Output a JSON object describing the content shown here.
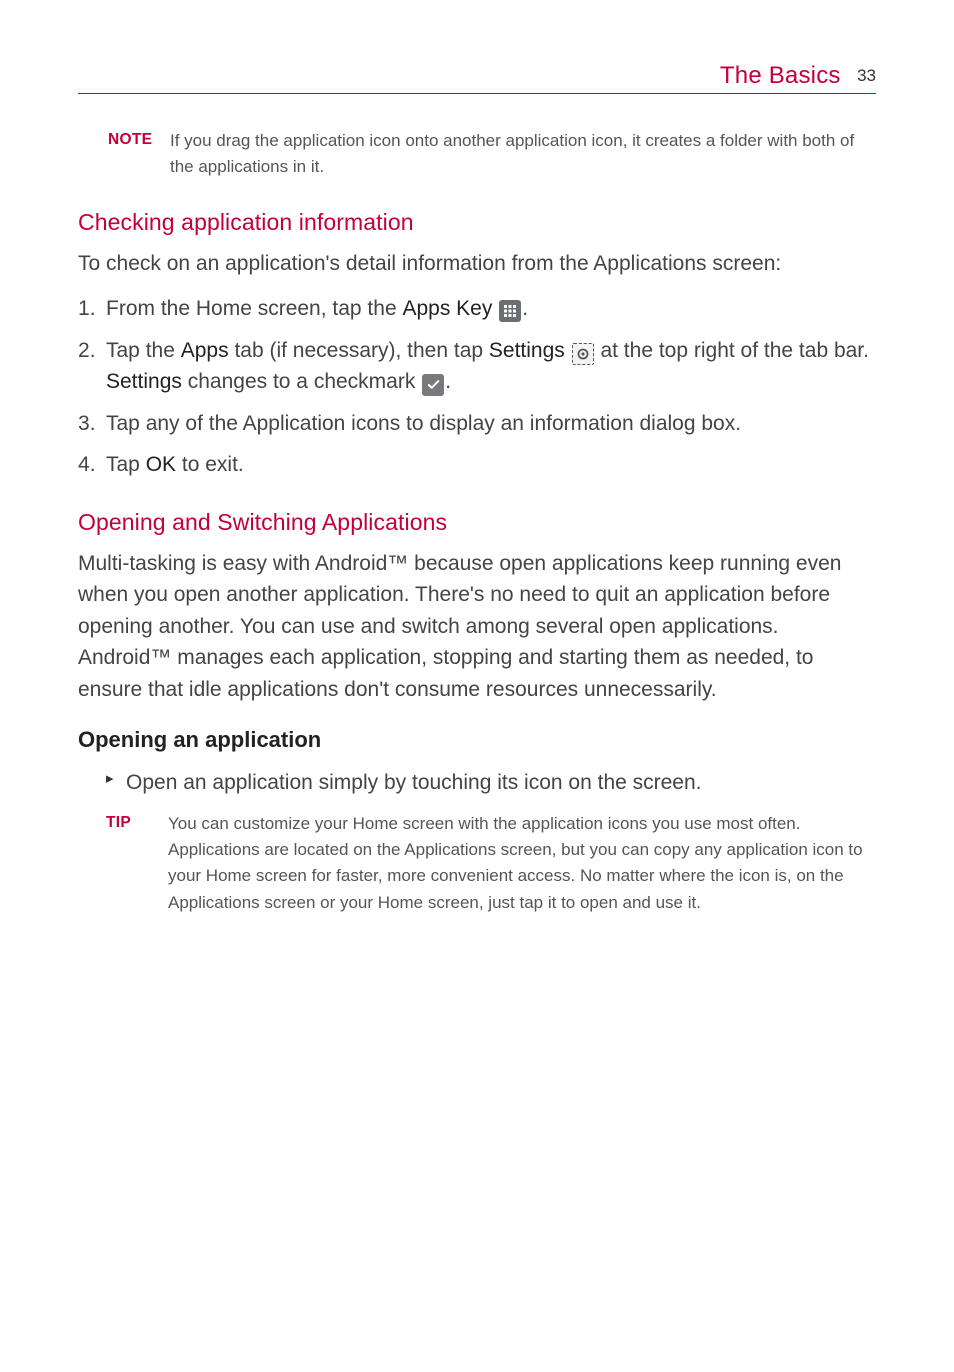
{
  "header": {
    "section_title": "The Basics",
    "page_number": "33"
  },
  "note": {
    "label": "NOTE",
    "text": "If you drag the application icon onto another application icon, it creates a folder with both of the applications in it."
  },
  "section_check": {
    "title": "Checking application information",
    "intro": "To check on an application's detail information from the Applications screen:",
    "steps": {
      "s1_a": "From the Home screen, tap the ",
      "s1_b": "Apps Key ",
      "s1_c": ".",
      "s2_a": "Tap the ",
      "s2_b": "Apps",
      "s2_c": " tab (if necessary), then tap ",
      "s2_d": "Settings ",
      "s2_e": " at the top right of the tab bar. ",
      "s2_f": "Settings",
      "s2_g": " changes to a checkmark ",
      "s2_h": ".",
      "s3": "Tap any of the Application icons to display an information dialog box.",
      "s4_a": "Tap ",
      "s4_b": "OK",
      "s4_c": " to exit."
    }
  },
  "section_open": {
    "title": "Opening and Switching Applications",
    "body": "Multi-tasking is easy with Android™ because open applications keep running even when you open another application. There's no need to quit an application before opening another. You can use and switch among several open applications. Android™ manages each application, stopping and starting them as needed, to ensure that idle applications don't consume resources unnecessarily."
  },
  "subsection_open": {
    "heading": "Opening an application",
    "bullet": "Open an application simply by touching its icon on the screen.",
    "tip": {
      "label": "TIP",
      "text": "You can customize your Home screen with the application icons you use most often. Applications are located on the Applications screen, but you can copy any application icon to your Home screen for faster, more convenient access. No matter where the icon is, on the Applications screen or your Home screen, just tap it to open and use it."
    }
  }
}
